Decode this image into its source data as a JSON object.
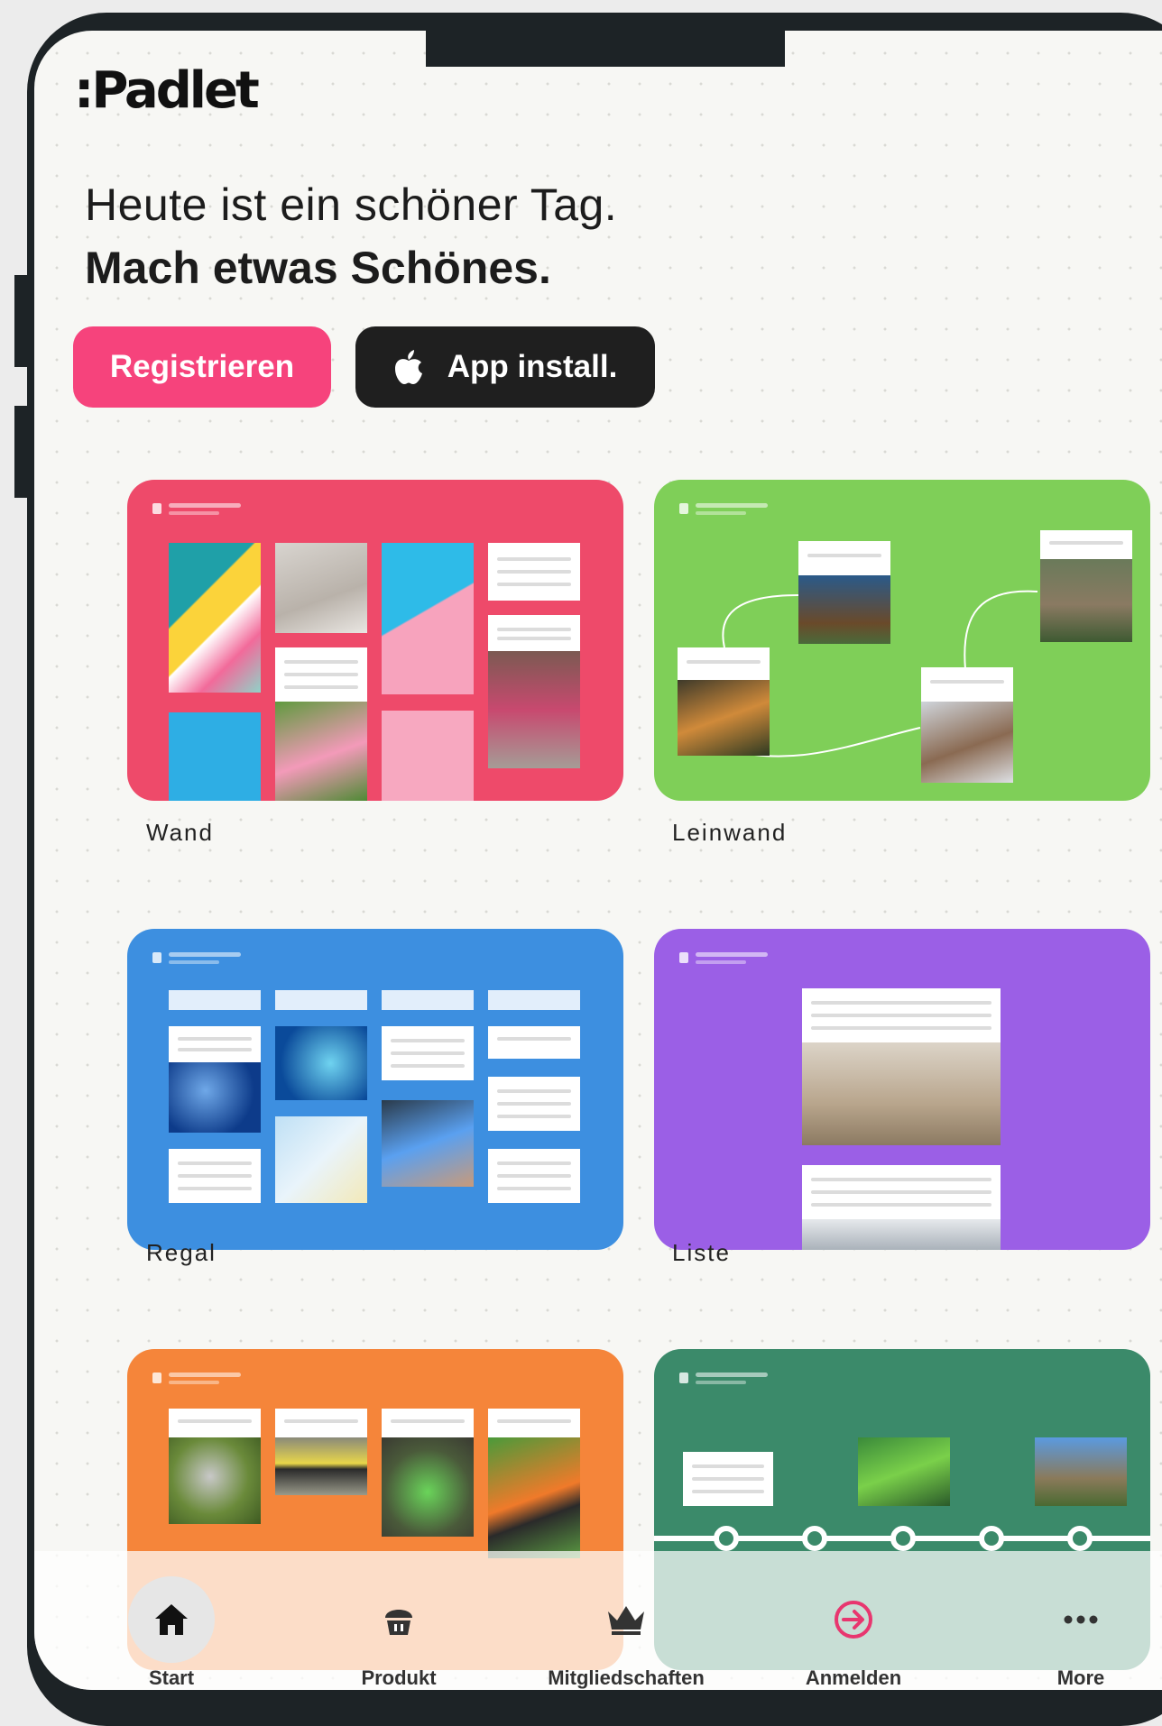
{
  "brand": {
    "logo_text": ":Padlet"
  },
  "hero": {
    "line1": "Heute ist ein schöner Tag.",
    "line2": "Mach etwas Schönes."
  },
  "actions": {
    "register_label": "Registrieren",
    "app_label": "App install."
  },
  "formats": [
    {
      "label": "Wand",
      "color": "#ee4a6a"
    },
    {
      "label": "Leinwand",
      "color": "#7fcf58"
    },
    {
      "label": "Regal",
      "color": "#3d8fe0"
    },
    {
      "label": "Liste",
      "color": "#9b5fe6"
    },
    {
      "label": "",
      "color": "#f5853a"
    },
    {
      "label": "",
      "color": "#3b8a6a"
    }
  ],
  "tabbar": {
    "items": [
      {
        "label": "Start",
        "icon": "home-icon",
        "active": true
      },
      {
        "label": "Produkt",
        "icon": "cupcake-icon"
      },
      {
        "label": "Mitgliedschaften",
        "icon": "crown-icon"
      },
      {
        "label": "Anmelden",
        "icon": "login-arrow-icon",
        "accent": "#e8366f"
      },
      {
        "label": "More",
        "icon": "more-dots-icon"
      }
    ]
  }
}
